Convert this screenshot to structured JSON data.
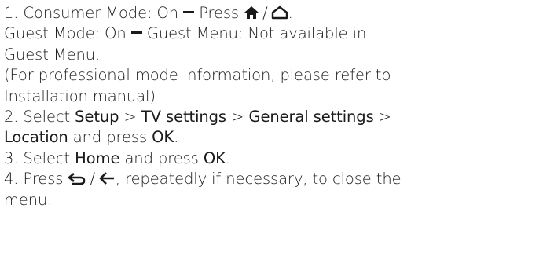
{
  "icons": {
    "home_filled": "home-filled-icon",
    "home_outline": "home-outline-icon",
    "back_curved": "back-curved-arrow-icon",
    "back_arrow": "left-arrow-icon"
  },
  "l1": {
    "a": "1. Consumer Mode: On ",
    "b": " Press ",
    "sep": "/",
    "end": "."
  },
  "l2": {
    "a": "Guest Mode: On ",
    "b": " Guest Menu: Not available in"
  },
  "l3": {
    "a": "Guest Menu."
  },
  "l4": {
    "a": "(For professional mode information, please refer to"
  },
  "l5": {
    "a": "Installation manual)"
  },
  "l6": {
    "a": "2. Select ",
    "setup": "Setup",
    "gt1": " > ",
    "tvsettings": "TV settings",
    "gt2": " > ",
    "general": "General settings",
    "gt3": " >"
  },
  "l7": {
    "location": "Location",
    "mid": " and press ",
    "ok": "OK",
    "end": "."
  },
  "l8": {
    "a": "3. Select ",
    "home": "Home",
    "mid": " and press ",
    "ok": "OK",
    "end": "."
  },
  "l9": {
    "a": "4. Press ",
    "sep": "/",
    "rest": ", repeatedly if necessary, to close the"
  },
  "l10": {
    "a": "menu."
  }
}
